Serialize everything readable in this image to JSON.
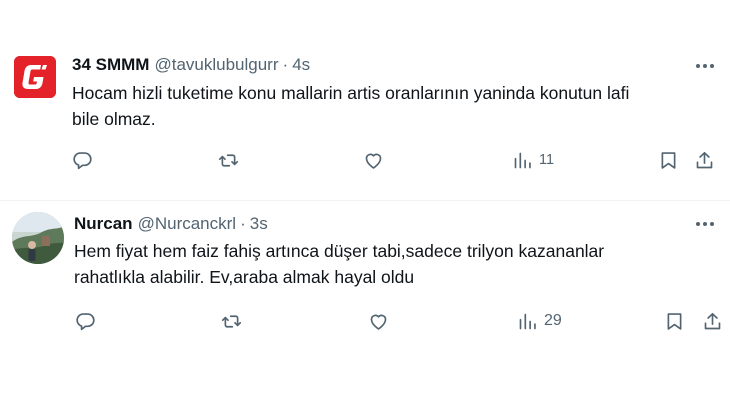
{
  "tweets": [
    {
      "display_name": "34 SMMM",
      "handle": "@tavuklubulgurr",
      "separator": "·",
      "time": "4s",
      "text_lines": [
        "Hocam hizli tuketime konu mallarin artis oranlarının yaninda konutun lafi",
        "bile olmaz."
      ],
      "views": "11",
      "avatar_icon": "logo-g-icon",
      "avatar_color": "#e3222a"
    },
    {
      "display_name": "Nurcan",
      "handle": "@Nurcanckrl",
      "separator": "·",
      "time": "3s",
      "text_lines": [
        "Hem fiyat hem faiz fahiş artınca düşer tabi,sadece trilyon kazananlar",
        "rahatlıkla alabilir. Ev,araba almak hayal oldu"
      ],
      "views": "29",
      "avatar_icon": "profile-photo"
    }
  ],
  "icons": {
    "more": "more-horizontal-icon",
    "reply": "reply-icon",
    "retweet": "retweet-icon",
    "like": "heart-icon",
    "views": "views-chart-icon",
    "bookmark": "bookmark-icon",
    "share": "share-icon"
  },
  "colors": {
    "text_primary": "#0f1419",
    "text_secondary": "#536471",
    "divider": "#eff3f4"
  }
}
